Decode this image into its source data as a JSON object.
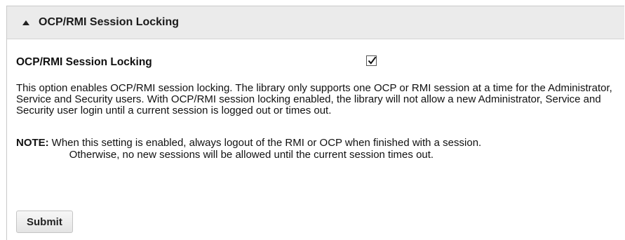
{
  "section": {
    "title": "OCP/RMI Session Locking",
    "collapse_icon": "triangle-up-icon",
    "expanded": true
  },
  "setting": {
    "label": "OCP/RMI Session Locking",
    "checked": true,
    "checkbox_icon": "checkmark-icon"
  },
  "description": "This option enables OCP/RMI session locking. The library only supports one OCP or RMI session at a time for the Administrator, Service and Security users. With OCP/RMI session locking enabled, the library will not allow a new Administrator, Service and Security user login until a current session is logged out or times out.",
  "note": {
    "label": "NOTE:",
    "line1": "When this setting is enabled, always logout of the RMI or OCP when finished with a session.",
    "line2": "Otherwise, no new sessions will be allowed until the current session times out."
  },
  "submit_label": "Submit"
}
